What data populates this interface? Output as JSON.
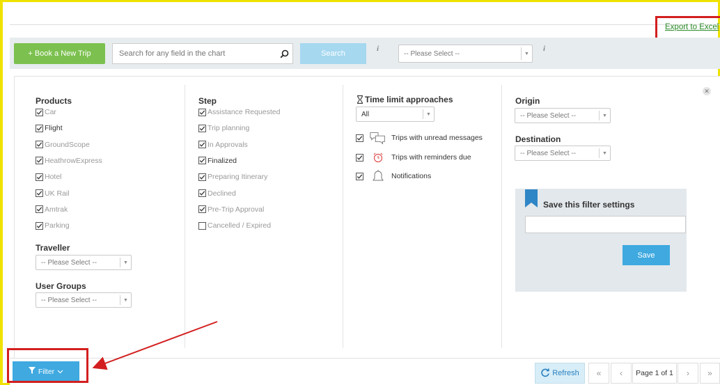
{
  "header": {
    "export_label": "Export to Excel"
  },
  "toolbar": {
    "book_label": "+ Book a New Trip",
    "search_placeholder": "Search for any field in the chart",
    "search_label": "Search",
    "info": "i",
    "select_value": "-- Please Select --"
  },
  "products": {
    "heading": "Products",
    "items": [
      {
        "label": "Car",
        "checked": true
      },
      {
        "label": "Flight",
        "checked": true
      },
      {
        "label": "GroundScope",
        "checked": true
      },
      {
        "label": "HeathrowExpress",
        "checked": true
      },
      {
        "label": "Hotel",
        "checked": true
      },
      {
        "label": "UK Rail",
        "checked": true
      },
      {
        "label": "Amtrak",
        "checked": true
      },
      {
        "label": "Parking",
        "checked": true
      }
    ]
  },
  "traveller": {
    "heading": "Traveller",
    "value": "-- Please Select --"
  },
  "user_groups": {
    "heading": "User Groups",
    "value": "-- Please Select --"
  },
  "step": {
    "heading": "Step",
    "items": [
      {
        "label": "Assistance Requested",
        "checked": true
      },
      {
        "label": "Trip planning",
        "checked": true
      },
      {
        "label": "In Approvals",
        "checked": true
      },
      {
        "label": "Finalized",
        "checked": true
      },
      {
        "label": "Preparing Itinerary",
        "checked": true
      },
      {
        "label": "Declined",
        "checked": true
      },
      {
        "label": "Pre-Trip Approval",
        "checked": true
      },
      {
        "label": "Cancelled / Expired",
        "checked": false
      }
    ]
  },
  "time_limit": {
    "heading": "Time limit approaches",
    "value": "All",
    "items": [
      {
        "label": "Trips with unread messages",
        "icon": "chat-bubbles-icon"
      },
      {
        "label": "Trips with reminders due",
        "icon": "alarm-clock-icon"
      },
      {
        "label": "Notifications",
        "icon": "bell-icon"
      }
    ]
  },
  "origin": {
    "heading": "Origin",
    "value": "-- Please Select --"
  },
  "destination": {
    "heading": "Destination",
    "value": "-- Please Select --"
  },
  "save_filter": {
    "title": "Save this filter settings",
    "save_label": "Save"
  },
  "footer": {
    "filter_label": "Filter",
    "refresh_label": "Refresh",
    "page_label": "Page 1 of 1",
    "first": "«",
    "prev": "‹",
    "next": "›",
    "last": "»"
  },
  "colors": {
    "accent": "#3fa9e0",
    "book_green": "#7cc14f",
    "export_green": "#2a8a26",
    "highlight_red": "#d31f1f",
    "frame_yellow": "#f0e200"
  }
}
